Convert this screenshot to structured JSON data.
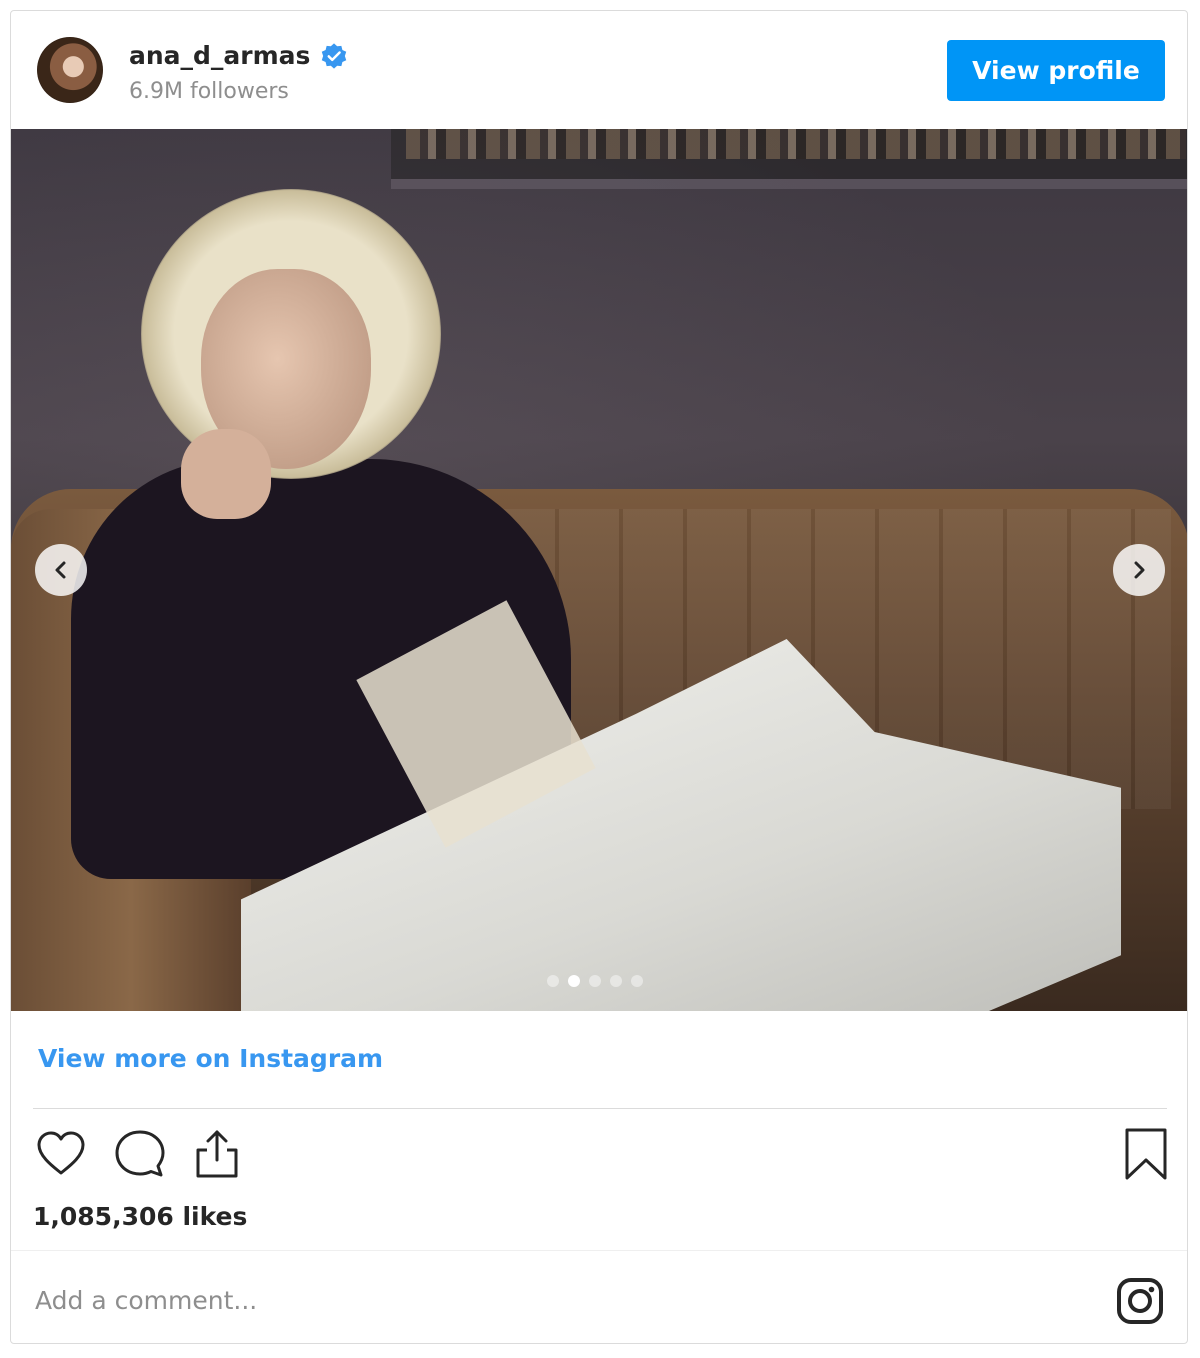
{
  "header": {
    "username": "ana_d_armas",
    "followers": "6.9M followers",
    "view_profile_label": "View profile"
  },
  "carousel": {
    "slide_count": 5,
    "active_index": 1
  },
  "links": {
    "view_more": "View more on Instagram"
  },
  "stats": {
    "likes": "1,085,306 likes"
  },
  "comment": {
    "placeholder": "Add a comment..."
  },
  "colors": {
    "accent": "#0095f6",
    "link": "#3897f0",
    "verified": "#3897f0"
  },
  "icons": [
    "verified-badge-icon",
    "chevron-left-icon",
    "chevron-right-icon",
    "heart-icon",
    "comment-icon",
    "share-icon",
    "bookmark-icon",
    "instagram-icon"
  ]
}
